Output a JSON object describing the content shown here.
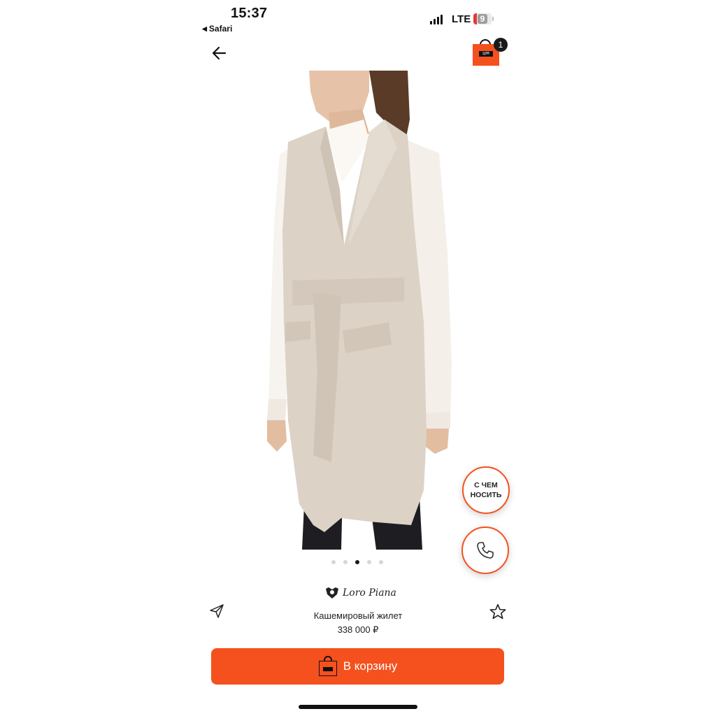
{
  "status_bar": {
    "time": "15:37",
    "back_app": "Safari",
    "network": "LTE",
    "battery": "9"
  },
  "header": {
    "cart_count": "1",
    "cart_logo_text": "ЦУМ"
  },
  "gallery": {
    "total": 5,
    "active_index": 2
  },
  "floating": {
    "what_to_wear": "С ЧЕМ НОСИТЬ"
  },
  "product": {
    "brand": "Loro Piana",
    "name": "Кашемировый жилет",
    "price": "338 000 ₽"
  },
  "actions": {
    "add_to_cart": "В корзину"
  },
  "colors": {
    "accent": "#f4511e",
    "vest": "#dcd2c6",
    "shirt": "#f7f3ee"
  }
}
